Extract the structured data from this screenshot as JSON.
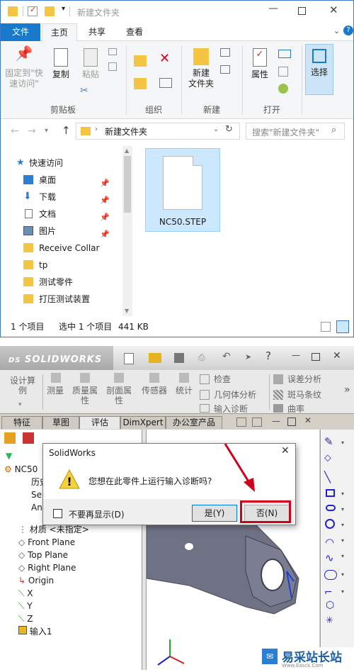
{
  "explorer": {
    "title": "新建文件夹",
    "tabs": {
      "file": "文件",
      "home": "主页",
      "share": "共享",
      "view": "查看"
    },
    "ribbon": {
      "pin": "固定到\"快\n速访问\"",
      "copy": "复制",
      "paste": "粘贴",
      "new_folder": "新建\n文件夹",
      "properties": "属性",
      "select": "选择",
      "groups": {
        "clipboard": "剪贴板",
        "organize": "组织",
        "new": "新建",
        "open": "打开"
      }
    },
    "address": {
      "path": "新建文件夹",
      "search_placeholder": "搜索\"新建文件夹\""
    },
    "nav": {
      "quick_access": "快速访问",
      "items": [
        "桌面",
        "下载",
        "文档",
        "图片",
        "Receive Collar",
        "tp",
        "测试零件",
        "打压测试装置"
      ]
    },
    "file": {
      "name": "NC50.STEP"
    },
    "status": {
      "count": "1 个项目",
      "selected": "选中 1 个项目",
      "size": "441 KB"
    }
  },
  "solidworks": {
    "logo": "SOLIDWORKS",
    "toolbar": {
      "design_study": "设计算\n例",
      "measure": "测量",
      "mass_props": "质量属\n性",
      "section_props": "剖面属\n性",
      "sensor": "传感器",
      "statistics": "统计",
      "check": "检查",
      "geometry": "几何体分析",
      "import_diag": "输入诊断",
      "deviation": "误差分析",
      "zebra": "斑马条纹",
      "curvature": "曲率"
    },
    "tabs": [
      "特征",
      "草图",
      "评估",
      "DimXpert",
      "办公室产品"
    ],
    "tree": {
      "root": "NC50",
      "history": "历史",
      "sensors": "Ser",
      "annotations": "An",
      "material": "材质 <未指定>",
      "front": "Front Plane",
      "top": "Top Plane",
      "right": "Right Plane",
      "origin": "Origin",
      "x": "X",
      "y": "Y",
      "z": "Z",
      "import1": "输入1"
    },
    "dialog": {
      "title": "SolidWorks",
      "message": "您想在此零件上运行输入诊断吗?",
      "checkbox": "不要再显示(D)",
      "yes": "是(Y)",
      "no": "否(N)"
    }
  },
  "watermark": {
    "text": "易采站长站",
    "url": "Www.Easck.Com"
  },
  "colors": {
    "file_tab": "#1979ca",
    "highlight": "#d0021b",
    "accent": "#0078d7"
  }
}
